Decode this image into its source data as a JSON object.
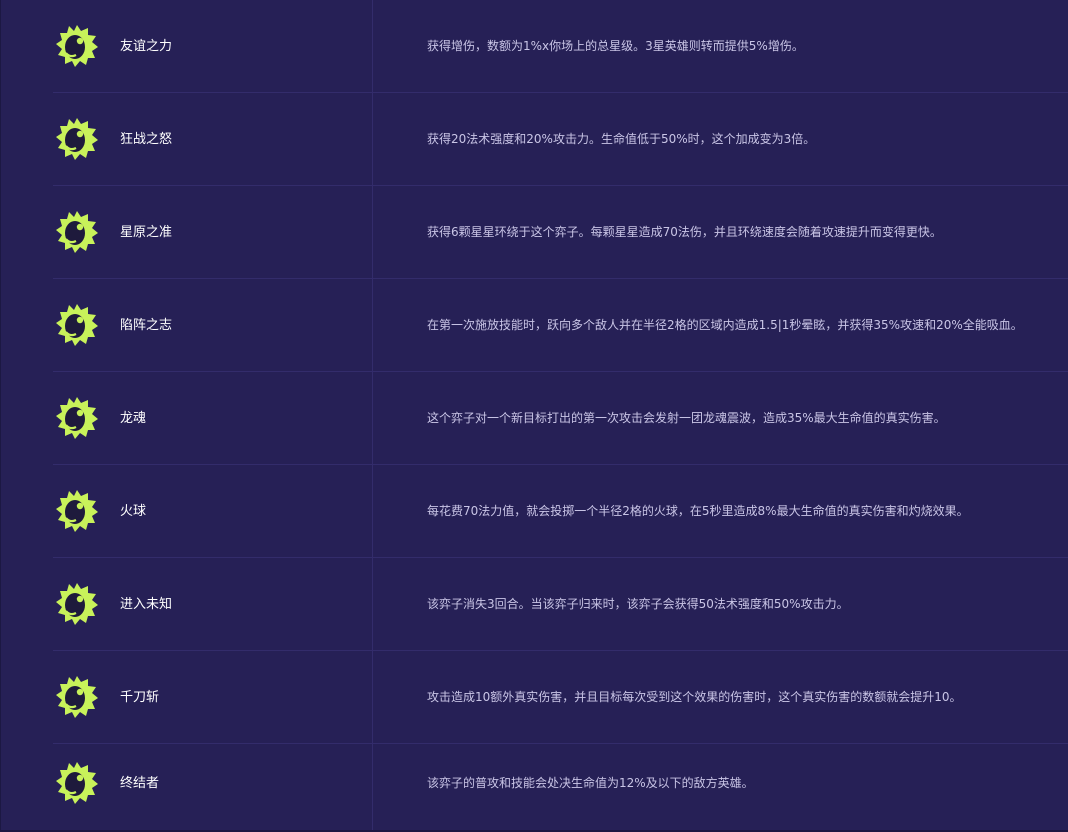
{
  "colors": {
    "background": "#262056",
    "divider": "#332c6b",
    "icon_fill": "#c8f25a",
    "name_text": "#ffffff",
    "desc_text": "#c9c5e6"
  },
  "icon_name": "gremlin-face-icon",
  "augments": [
    {
      "name": "友谊之力",
      "description": "获得增伤，数额为1%x你场上的总星级。3星英雄则转而提供5%增伤。"
    },
    {
      "name": "狂战之怒",
      "description": "获得20法术强度和20%攻击力。生命值低于50%时，这个加成变为3倍。"
    },
    {
      "name": "星原之准",
      "description": "获得6颗星星环绕于这个弈子。每颗星星造成70法伤，并且环绕速度会随着攻速提升而变得更快。"
    },
    {
      "name": "陷阵之志",
      "description": "在第一次施放技能时，跃向多个敌人并在半径2格的区域内造成1.5|1秒晕眩，并获得35%攻速和20%全能吸血。"
    },
    {
      "name": "龙魂",
      "description": "这个弈子对一个新目标打出的第一次攻击会发射一团龙魂震波，造成35%最大生命值的真实伤害。"
    },
    {
      "name": "火球",
      "description": "每花费70法力值，就会投掷一个半径2格的火球，在5秒里造成8%最大生命值的真实伤害和灼烧效果。"
    },
    {
      "name": "进入未知",
      "description": "该弈子消失3回合。当该弈子归来时，该弈子会获得50法术强度和50%攻击力。"
    },
    {
      "name": "千刀斩",
      "description": "攻击造成10额外真实伤害，并且目标每次受到这个效果的伤害时，这个真实伤害的数额就会提升10。"
    },
    {
      "name": "终结者",
      "description": "该弈子的普攻和技能会处决生命值为12%及以下的敌方英雄。"
    }
  ]
}
